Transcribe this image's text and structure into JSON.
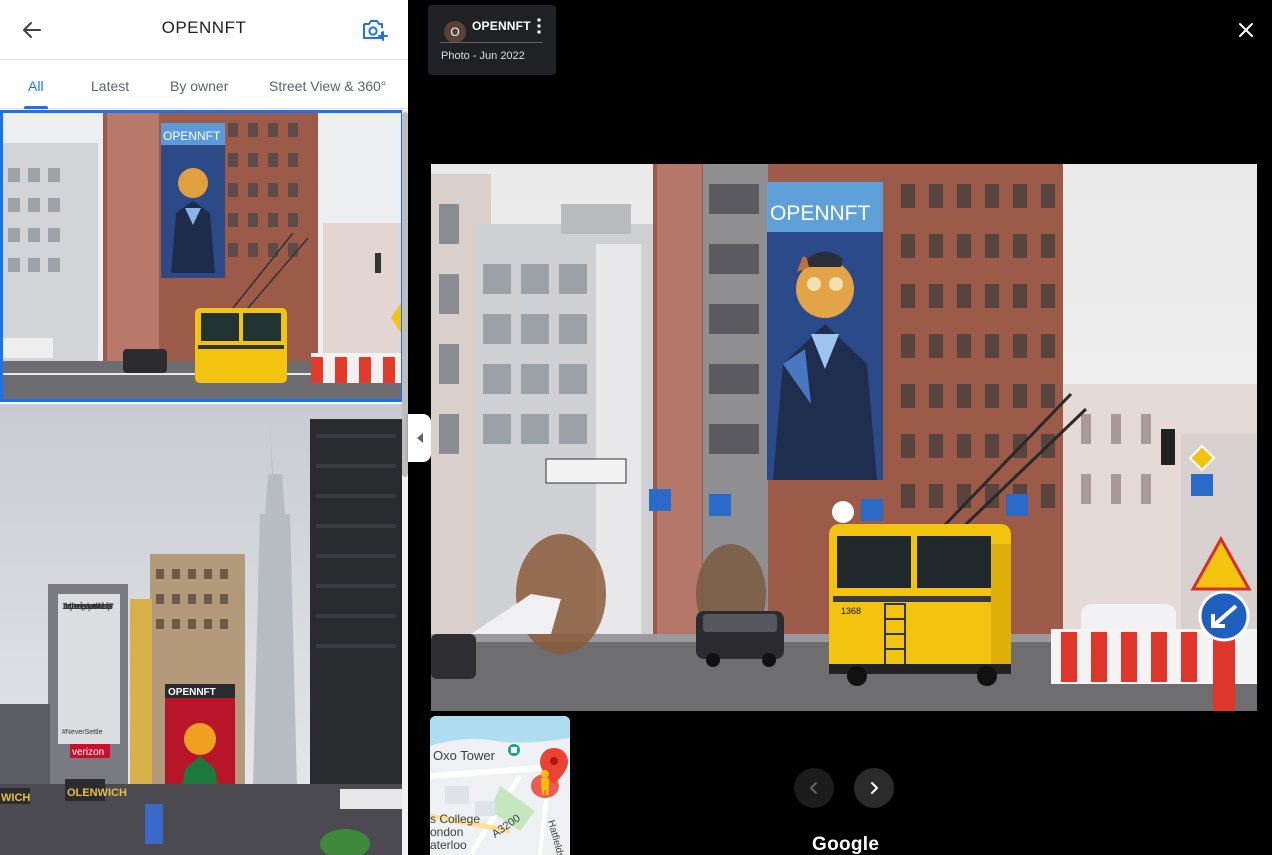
{
  "header": {
    "title": "OPENNFT"
  },
  "tabs": [
    {
      "label": "All",
      "selected": true
    },
    {
      "label": "Latest",
      "selected": false
    },
    {
      "label": "By owner",
      "selected": false
    },
    {
      "label": "Street View & 360°",
      "selected": false
    }
  ],
  "thumbnails": [
    {
      "billboard_text": "OPENNFT",
      "selected": true
    },
    {
      "billboard_text": "OPENNFT",
      "sign_text": "In the city that never sleeps, does your network take lots of naps?",
      "signature": "#NeverSettle",
      "store_sign_1": "verizon",
      "store_sign_2": "OLENWICH",
      "store_sign_3": "WICH"
    }
  ],
  "viewer": {
    "owner_initial": "O",
    "owner_name": "OPENNFT",
    "photo_meta": "Photo - Jun 2022",
    "billboard_text": "OPENNFT",
    "bus_number": "1368",
    "brand": "Google"
  },
  "minimap": {
    "labels": {
      "landmark": "Oxo Tower",
      "college": "s College",
      "london": "ondon",
      "waterloo": "aterloo",
      "road": "A3200",
      "street": "Hatfields"
    }
  },
  "colors": {
    "accent": "#1a73e8",
    "viewer_bg": "#000000",
    "card_bg": "#202124",
    "bus_yellow": "#f2c40f",
    "pin_red": "#ea4335"
  },
  "icons": {
    "back": "arrow-left-icon",
    "add_photo": "camera-plus-icon",
    "more": "more-vert-icon",
    "close": "close-icon",
    "prev": "chevron-left-icon",
    "next": "chevron-right-icon",
    "collapse": "caret-left-icon",
    "pegman": "pegman-icon",
    "pin": "location-pin-icon",
    "landmark": "landmark-icon"
  }
}
